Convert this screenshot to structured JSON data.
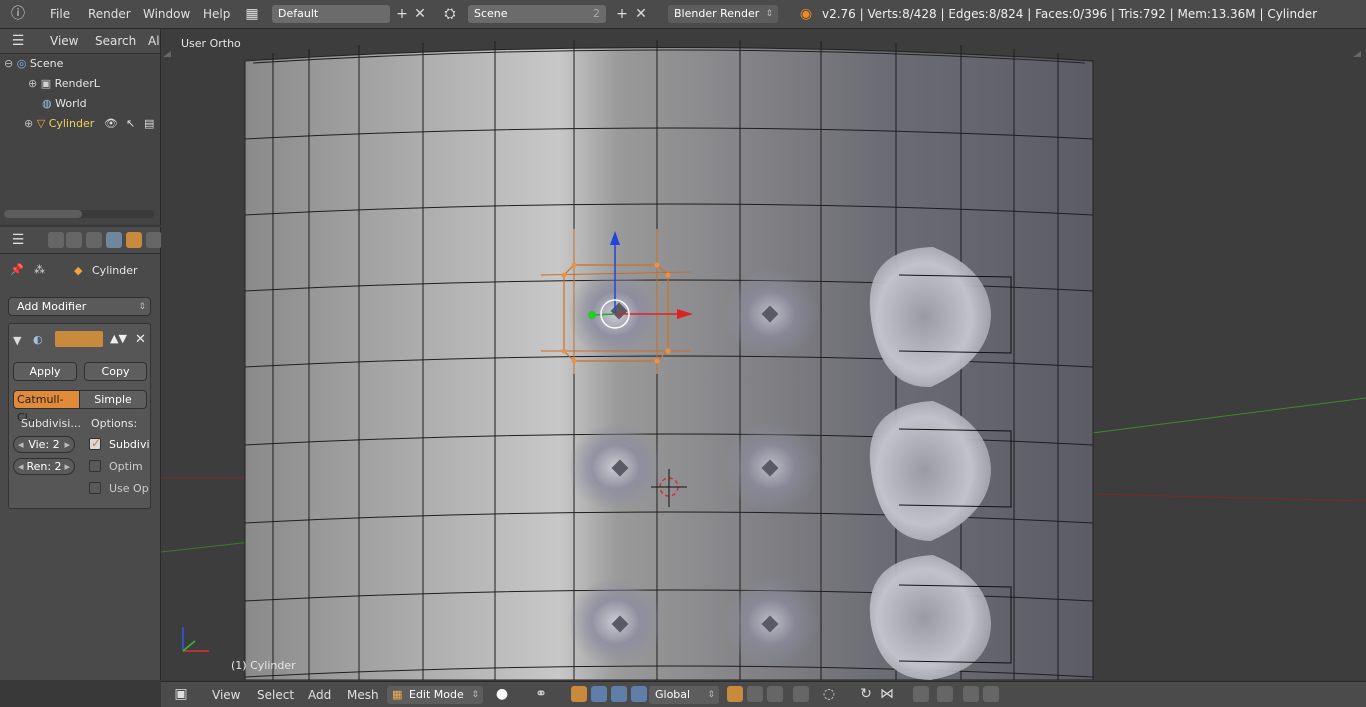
{
  "topbar": {
    "menus": [
      "File",
      "Render",
      "Window",
      "Help"
    ],
    "layout": "Default",
    "scene": "Scene",
    "scene_users": "2",
    "engine": "Blender Render",
    "info": "v2.76 | Verts:8/428 | Edges:8/824 | Faces:0/396 | Tris:792 | Mem:13.36M | Cylinder"
  },
  "outliner": {
    "menus": [
      "View",
      "Search",
      "Al"
    ],
    "items": [
      "Scene",
      "RenderL",
      "World",
      "Cylinder"
    ]
  },
  "properties": {
    "object_name": "Cylinder",
    "add_modifier": "Add Modifier",
    "apply": "Apply",
    "copy": "Copy",
    "catmull": "Catmull-Cl...",
    "simple": "Simple",
    "subdivisions_label": "Subdivisi...",
    "options_label": "Options:",
    "view_field": "Vie: 2",
    "render_field": "Ren: 2",
    "opt1": "Subdivi",
    "opt2": "Optim",
    "opt3": "Use Op"
  },
  "viewport": {
    "view_name": "User Ortho",
    "object_label": "(1) Cylinder"
  },
  "bottombar": {
    "menus": [
      "View",
      "Select",
      "Add",
      "Mesh"
    ],
    "mode": "Edit Mode",
    "orientation": "Global"
  }
}
